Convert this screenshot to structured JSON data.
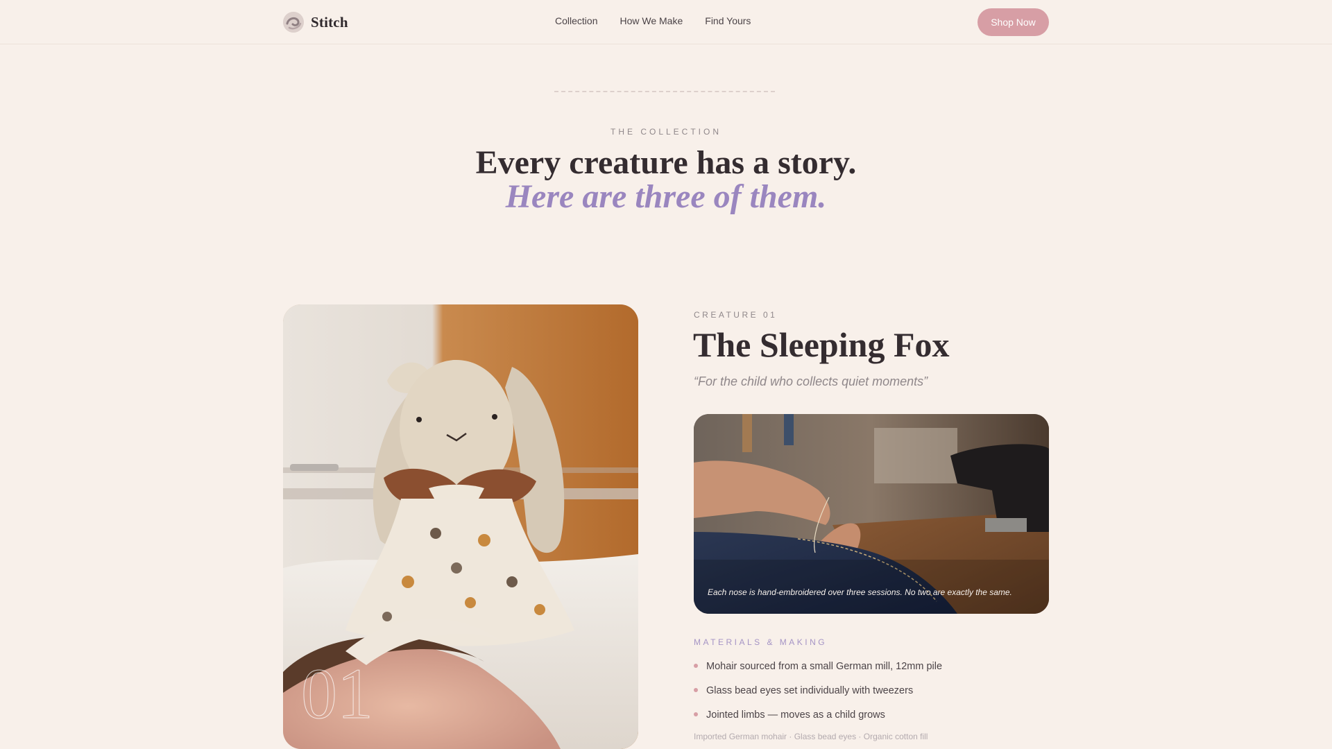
{
  "nav": {
    "brand": "Stitch",
    "links": [
      "Collection",
      "How We Make",
      "Find Yours"
    ],
    "cta": "Shop Now",
    "icons": {
      "brand": "swirl-logo-icon"
    }
  },
  "hero": {
    "eyebrow": "THE COLLECTION",
    "title": "Every creature has a story.",
    "subtitle": "Here are three of them."
  },
  "creature": {
    "label": "CREATURE 01",
    "name": "The Sleeping Fox",
    "quote": "“For the child who collects quiet moments”",
    "number": "01",
    "photo_caption": "Each nose is hand-embroidered over three sessions. No two are exactly the same.",
    "materials_label": "MATERIALS & MAKING",
    "materials": [
      "Mohair sourced from a small German mill, 12mm pile",
      "Glass bead eyes set individually with tweezers",
      "Jointed limbs — moves as a child grows"
    ],
    "tags": "Imported German mohair · Glass bead eyes · Organic cotton fill"
  },
  "colors": {
    "background": "#f8f0ea",
    "accent_pink": "#d79ea5",
    "accent_lavender": "#9a86bf",
    "text_dark": "#342c30"
  }
}
